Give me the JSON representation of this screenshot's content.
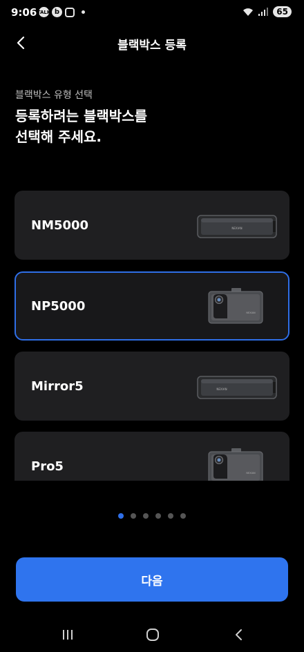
{
  "status_bar": {
    "time": "9:06",
    "app_icons": [
      "talk-icon",
      "b-icon",
      "instagram-icon"
    ],
    "talk_label": "TALK",
    "b_label": "b",
    "battery": "65"
  },
  "header": {
    "title": "블랙박스 등록"
  },
  "intro": {
    "subtitle": "블랙박스 유형 선택",
    "headline_line1": "등록하려는 블랙박스를",
    "headline_line2": "선택해 주세요."
  },
  "devices": [
    {
      "label": "NM5000",
      "type": "mirror",
      "selected": false,
      "brand": "NEXIAN"
    },
    {
      "label": "NP5000",
      "type": "dashcam",
      "selected": true,
      "brand": "NEXIAN"
    },
    {
      "label": "Mirror5",
      "type": "mirror",
      "selected": false,
      "brand": "NEXIAN"
    },
    {
      "label": "Pro5",
      "type": "dashcam",
      "selected": false,
      "brand": "NEXIAN"
    }
  ],
  "pager": {
    "count": 6,
    "active_index": 0
  },
  "next_button": {
    "label": "다음"
  },
  "colors": {
    "accent": "#2f74ee",
    "card_bg": "#1f1f21",
    "background": "#000000"
  }
}
